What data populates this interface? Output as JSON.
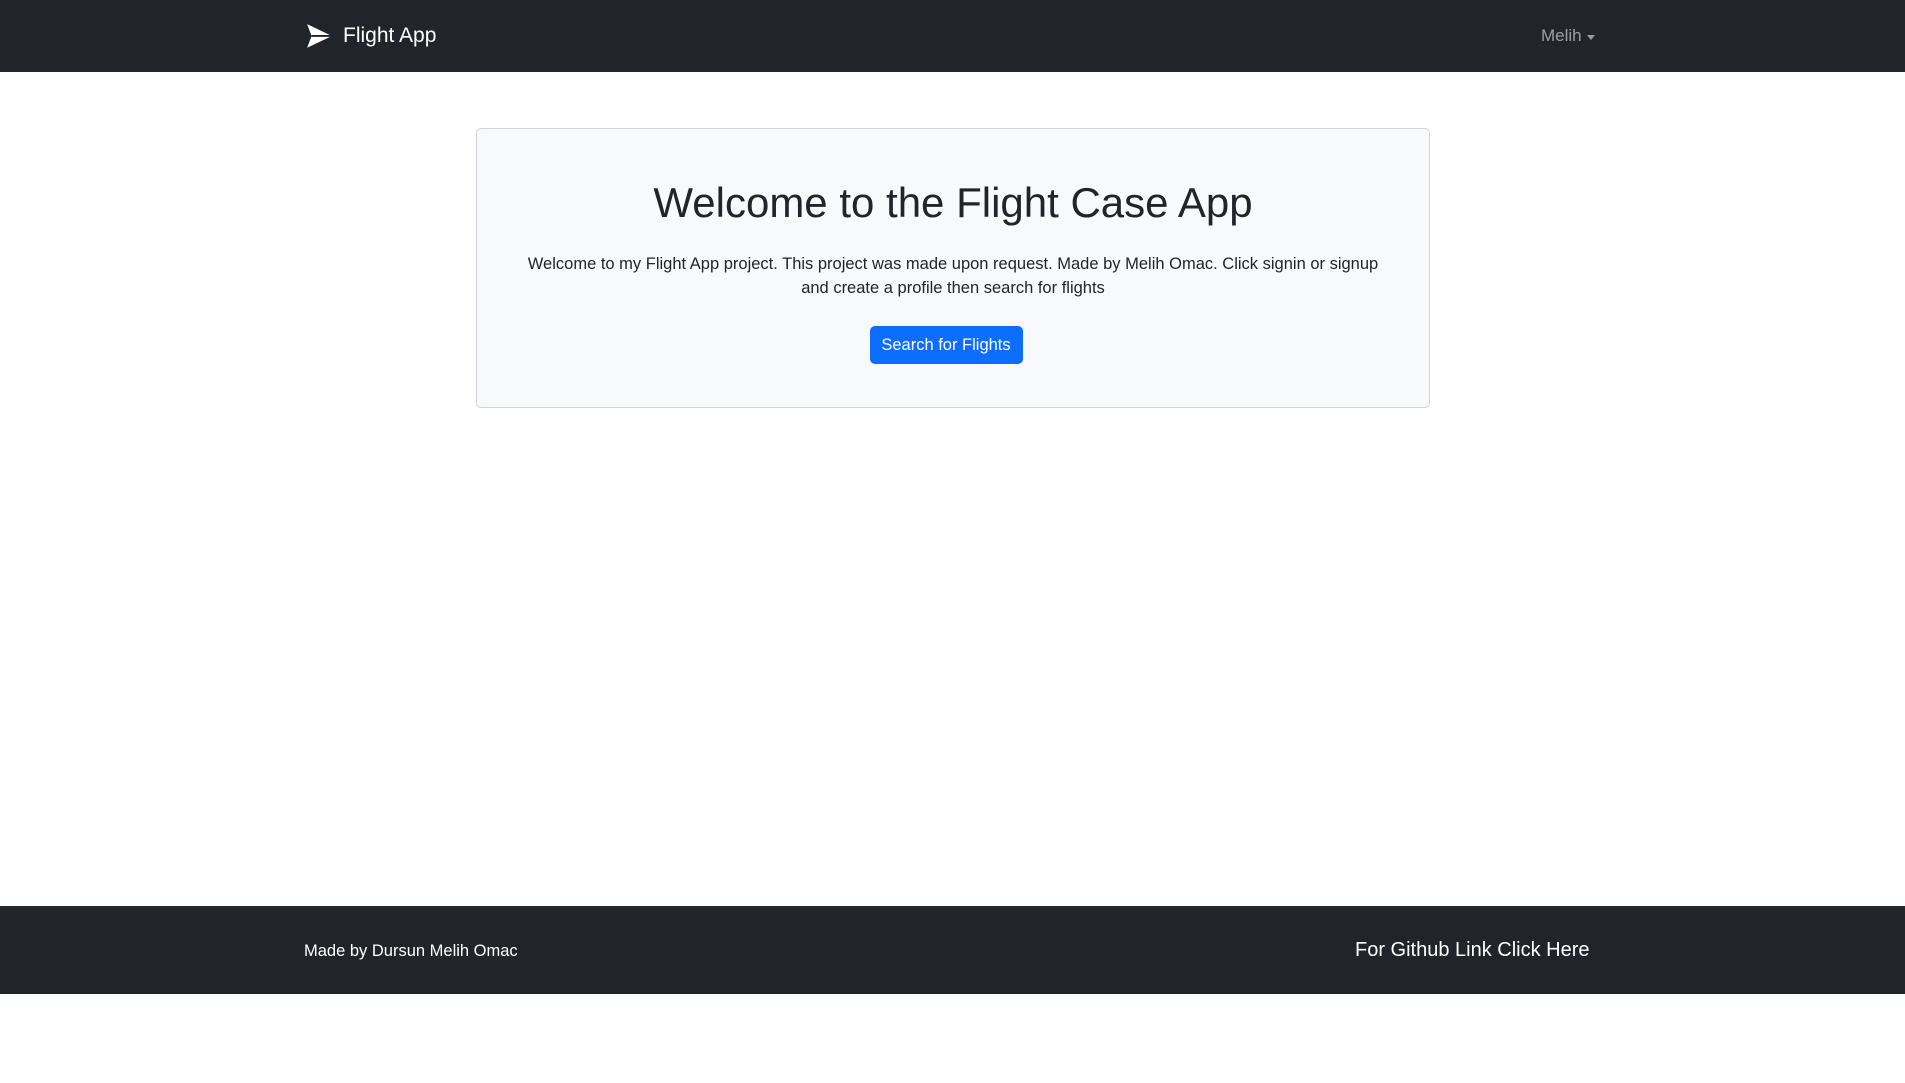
{
  "navbar": {
    "brand_label": "Flight App",
    "brand_icon": "paper-plane-icon",
    "user_label": "Melih",
    "user_icon": "chevron-down-icon"
  },
  "hero": {
    "title": "Welcome to the Flight Case App",
    "description": "Welcome to my Flight App project. This project was made upon request. Made by Melih Omac. Click signin or signup and create a profile then search for flights",
    "button_label": "Search for Flights"
  },
  "footer": {
    "credit": "Made by Dursun Melih Omac",
    "github_link": "For Github Link Click Here"
  },
  "colors": {
    "navbar_bg": "#212529",
    "primary": "#0d6efd",
    "hero_bg": "#f8f9fa"
  }
}
